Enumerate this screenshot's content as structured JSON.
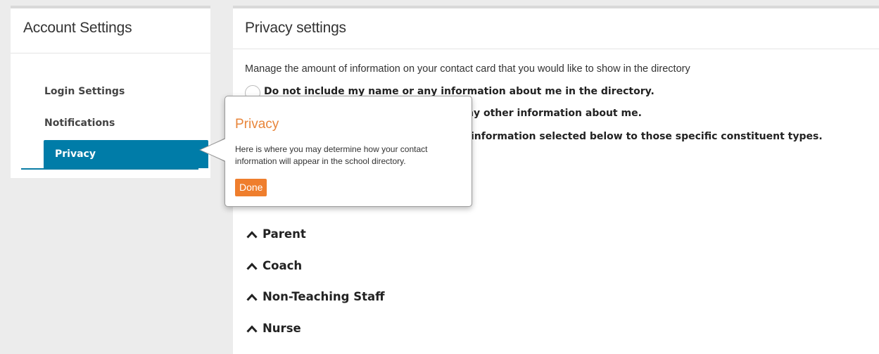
{
  "sidebar": {
    "title": "Account Settings",
    "items": [
      {
        "label": "Login Settings"
      },
      {
        "label": "Notifications"
      },
      {
        "label": "Privacy"
      }
    ]
  },
  "main": {
    "title": "Privacy settings",
    "description": "Manage the amount of information on your contact card that you would like to show in the directory",
    "options": [
      {
        "label": "Do not include my name or any information about me in the directory."
      },
      {
        "label": "ny other information about me."
      },
      {
        "label": "information selected below to those specific constituent types."
      }
    ],
    "sections": [
      {
        "label": "Parent"
      },
      {
        "label": "Coach"
      },
      {
        "label": "Non-Teaching Staff"
      },
      {
        "label": "Nurse"
      }
    ]
  },
  "popover": {
    "title": "Privacy",
    "body": "Here is where you may determine how your contact information will appear in the school directory.",
    "done_label": "Done"
  },
  "colors": {
    "accent_blue": "#007ca8",
    "popover_orange": "#e8853a",
    "done_orange": "#ef7e2d"
  },
  "icons": {
    "section_toggle": "chevron-up-icon"
  }
}
